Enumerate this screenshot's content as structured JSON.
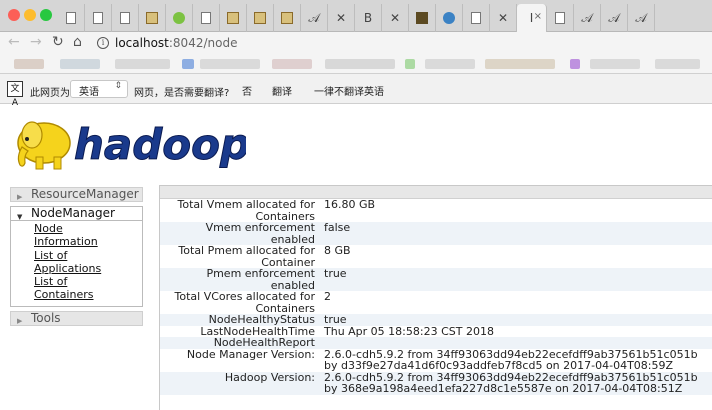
{
  "browser": {
    "tabs": [
      {
        "icon": "document-icon"
      },
      {
        "icon": "document-icon"
      },
      {
        "icon": "document-icon"
      },
      {
        "icon": "image-icon"
      },
      {
        "icon": "android-icon"
      },
      {
        "icon": "document-icon"
      },
      {
        "icon": "image-icon"
      },
      {
        "icon": "image-icon"
      },
      {
        "icon": "image-icon"
      },
      {
        "icon": "script-a-icon"
      },
      {
        "icon": "cross-icon"
      },
      {
        "icon": "b-icon"
      },
      {
        "icon": "cross-icon"
      },
      {
        "icon": "github-icon"
      },
      {
        "icon": "globe-icon"
      },
      {
        "icon": "document-icon"
      },
      {
        "icon": "cross-icon"
      },
      {
        "icon": "active-tab-icon",
        "active": true
      },
      {
        "icon": "document-icon"
      },
      {
        "icon": "script-a-icon"
      },
      {
        "icon": "script-a-icon"
      },
      {
        "icon": "script-a-icon"
      }
    ],
    "active_tab_text": "I",
    "address": {
      "host": "localhost",
      "path": ":8042/node"
    }
  },
  "translate_bar": {
    "icon_text": "文A",
    "prompt": "此网页为",
    "language": "英语",
    "question": "网页，是否需要翻译?",
    "no_label": "否",
    "translate_label": "翻译",
    "never_label": "一律不翻译英语"
  },
  "logo": {
    "text": "hadoop"
  },
  "sidebar": {
    "sections": [
      {
        "label": "ResourceManager",
        "expanded": false
      },
      {
        "label": "NodeManager",
        "expanded": true,
        "links": [
          "Node",
          "Information",
          "List of",
          "Applications",
          "List of",
          "Containers"
        ]
      },
      {
        "label": "Tools",
        "expanded": false
      }
    ]
  },
  "node_info": {
    "rows": [
      {
        "key": "Total Vmem allocated for Containers",
        "value": "16.80 GB"
      },
      {
        "key": "Vmem enforcement enabled",
        "value": "false"
      },
      {
        "key": "Total Pmem allocated for Container",
        "value": "8 GB"
      },
      {
        "key": "Pmem enforcement enabled",
        "value": "true"
      },
      {
        "key": "Total VCores allocated for Containers",
        "value": "2"
      },
      {
        "key": "NodeHealthyStatus",
        "value": "true"
      },
      {
        "key": "LastNodeHealthTime",
        "value": "Thu Apr 05 18:58:23 CST 2018"
      },
      {
        "key": "NodeHealthReport",
        "value": ""
      },
      {
        "key": "Node Manager Version:",
        "value": "2.6.0-cdh5.9.2 from 34ff93063dd94eb22ecefdff9ab37561b51c051b by d33f9e27da41d6f0c93addfeb7f8cd5 on 2017-04-04T08:59Z"
      },
      {
        "key": "Hadoop Version:",
        "value": "2.6.0-cdh5.9.2 from 34ff93063dd94eb22ecefdff9ab37561b51c051b by 368e9a198a4eed1efa227d8c1e5587e on 2017-04-04T08:51Z"
      }
    ]
  },
  "colors": {
    "accent_blue": "#1a3a8c",
    "logo_yellow": "#f5d31c",
    "row_alt": "#eef3f8"
  }
}
